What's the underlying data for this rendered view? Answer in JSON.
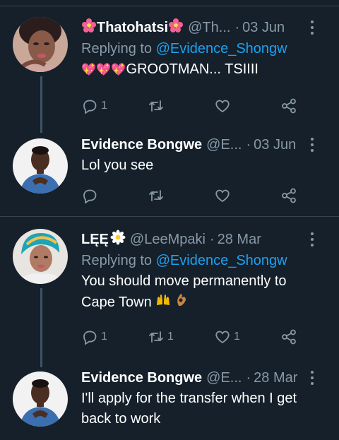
{
  "tweets": [
    {
      "name": "Thatohatsi",
      "handle": "@Th...",
      "date": "03 Jun",
      "replying_prefix": "Replying to",
      "replying_to": "@Evidence_Shongw",
      "text": "GROOTMAN... TSIIII",
      "text_emoji_prefix": "💖💖💖",
      "reply_count": "1",
      "retweet_count": "",
      "like_count": ""
    },
    {
      "name": "Evidence Bongwe",
      "handle": "@E...",
      "date": "03 Jun",
      "text": "Lol you see",
      "reply_count": "",
      "retweet_count": "",
      "like_count": ""
    },
    {
      "name": "LĘĘ",
      "handle": "@LeeMpaki",
      "date": "28 Mar",
      "replying_prefix": "Replying to",
      "replying_to": "@Evidence_Shongw",
      "text_line1": "You should move permanently to",
      "text_line2": "Cape Town",
      "reply_count": "1",
      "retweet_count": "1",
      "like_count": "1"
    },
    {
      "name": "Evidence Bongwe",
      "handle": "@E...",
      "date": "28 Mar",
      "text_line1": "I'll apply for the transfer when I get",
      "text_line2": "back to work"
    }
  ],
  "colors": {
    "background": "#15202b",
    "muted": "#8899a6",
    "link": "#1da1f2",
    "divider": "#38444d"
  },
  "icons": [
    "reply-icon",
    "retweet-icon",
    "like-icon",
    "share-icon",
    "more-icon"
  ]
}
